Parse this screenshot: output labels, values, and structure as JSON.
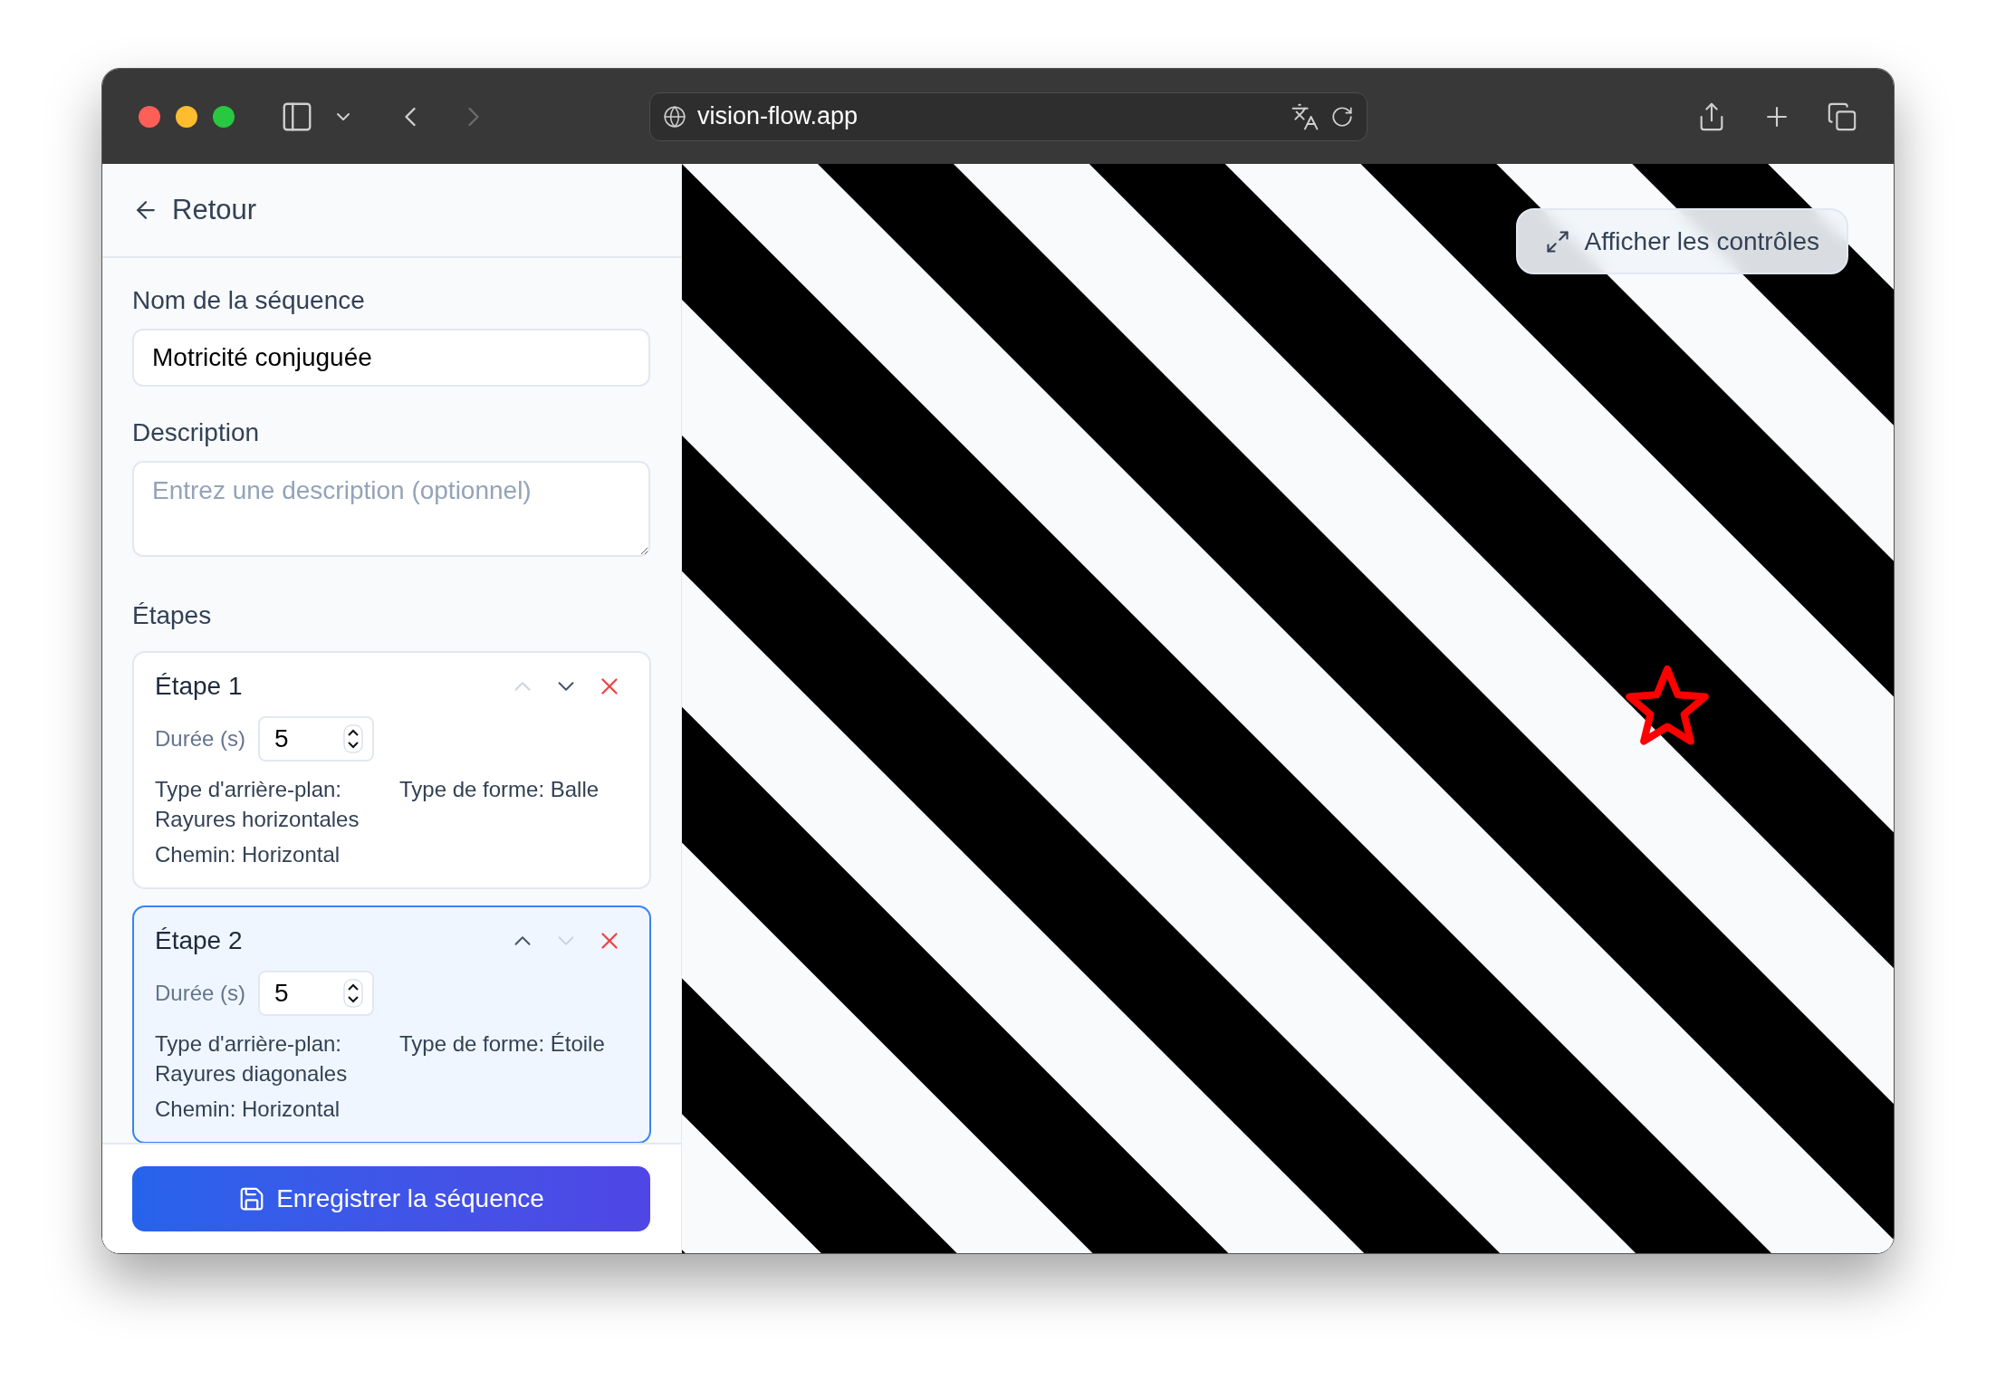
{
  "browser": {
    "url": "vision-flow.app"
  },
  "sidebar": {
    "back_link": "Retour",
    "name_field": {
      "label": "Nom de la séquence",
      "value": "Motricité conjuguée"
    },
    "description_field": {
      "label": "Description",
      "placeholder": "Entrez une description (optionnel)"
    },
    "steps_heading": "Étapes",
    "steps": [
      {
        "title": "Étape 1",
        "selected": false,
        "move_up_disabled": true,
        "move_down_disabled": false,
        "duration_label": "Durée (s)",
        "duration": "5",
        "background": "Type d'arrière-plan: Rayures horizontales",
        "shape": "Type de forme: Balle",
        "path": "Chemin: Horizontal"
      },
      {
        "title": "Étape 2",
        "selected": true,
        "move_up_disabled": false,
        "move_down_disabled": true,
        "duration_label": "Durée (s)",
        "duration": "5",
        "background": "Type d'arrière-plan: Rayures diagonales",
        "shape": "Type de forme: Étoile",
        "path": "Chemin: Horizontal"
      }
    ],
    "save_button": "Enregistrer la séquence"
  },
  "preview": {
    "toggle_button": "Afficher les contrôles"
  }
}
